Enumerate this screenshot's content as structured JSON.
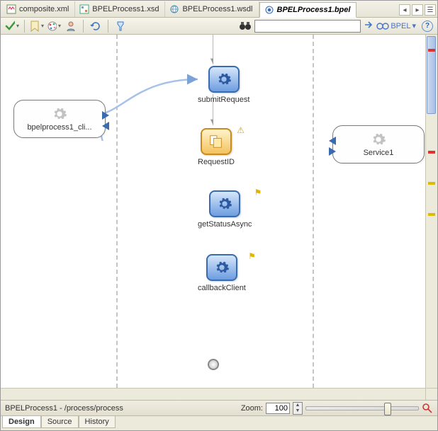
{
  "tabs": [
    {
      "label": "composite.xml",
      "icon": "xml-icon"
    },
    {
      "label": "BPELProcess1.xsd",
      "icon": "xsd-icon"
    },
    {
      "label": "BPELProcess1.wsdl",
      "icon": "wsdl-icon"
    },
    {
      "label": "BPELProcess1.bpel",
      "icon": "bpel-icon",
      "active": true
    }
  ],
  "toolbar_right": {
    "bpel_label": "BPEL"
  },
  "partners": {
    "left": {
      "label": "bpelprocess1_cli..."
    },
    "right": {
      "label": "Service1"
    }
  },
  "activities": {
    "a1": {
      "label": "submitRequest"
    },
    "a2": {
      "label": "RequestID"
    },
    "a3": {
      "label": "getStatusAsync"
    },
    "a4": {
      "label": "callbackClient"
    }
  },
  "statusbar": {
    "path": "BPELProcess1 - /process/process",
    "zoom_label": "Zoom:",
    "zoom_value": "100"
  },
  "footer_tabs": [
    "Design",
    "Source",
    "History"
  ],
  "active_footer": "Design"
}
